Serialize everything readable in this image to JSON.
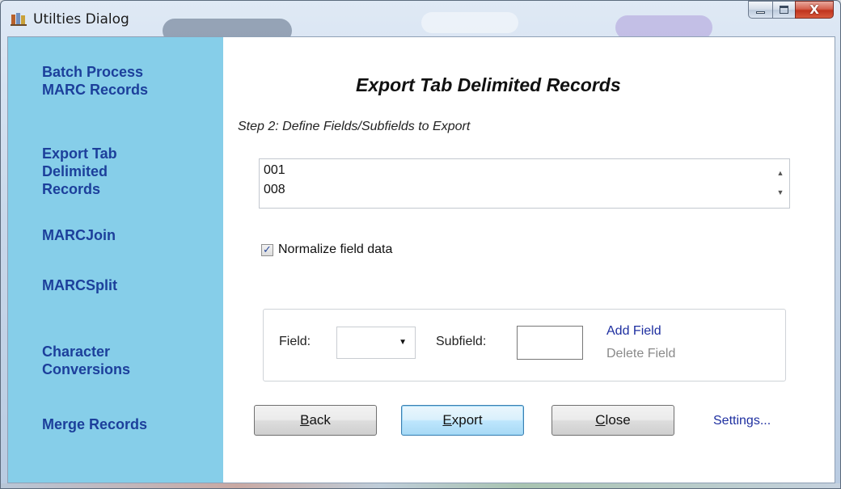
{
  "window": {
    "title": "Utilties Dialog",
    "icon": "app-books-icon",
    "caption_buttons": {
      "minimize": "minimize-icon",
      "maximize": "maximize-icon",
      "close_glyph": "X"
    }
  },
  "sidebar": {
    "background": "#86cee9",
    "link_color": "#1c3f9b",
    "items": [
      {
        "line1": "Batch Process",
        "line2": "MARC Records"
      },
      {
        "line1": "Export Tab",
        "line2": "Delimited",
        "line3": "Records"
      },
      {
        "line1": "MARCJoin"
      },
      {
        "line1": "MARCSplit"
      },
      {
        "line1": "Character",
        "line2": "Conversions"
      },
      {
        "line1": "Merge Records"
      }
    ]
  },
  "main": {
    "title": "Export Tab Delimited Records",
    "step": "Step 2:  Define Fields/Subfields to Export",
    "field_list": [
      "001",
      "008"
    ],
    "normalize": {
      "label": "Normalize field data",
      "checked": true
    },
    "field_group": {
      "field_label": "Field:",
      "field_value": "",
      "subfield_label": "Subfield:",
      "subfield_value": "",
      "add_link": "Add Field",
      "delete_link": "Delete Field"
    },
    "buttons": {
      "back_mnemonic": "B",
      "back_rest": "ack",
      "export_mnemonic": "E",
      "export_rest": "xport",
      "close_mnemonic": "C",
      "close_rest": "lose"
    },
    "settings_link": "Settings..."
  }
}
